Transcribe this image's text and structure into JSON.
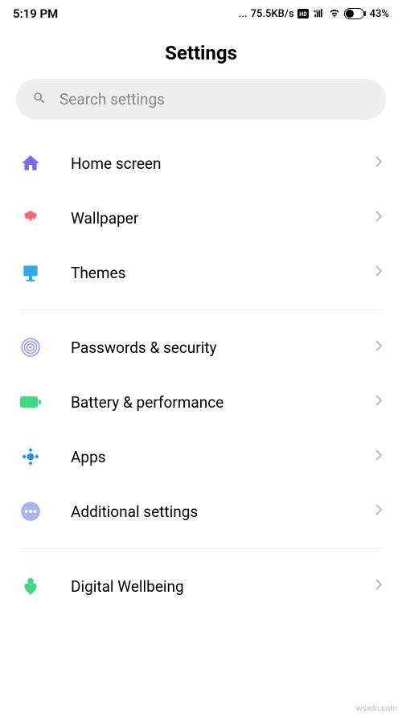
{
  "status_bar": {
    "time": "5:19 PM",
    "net_speed": "75.5KB/s",
    "battery_percent": "43%",
    "dots": "..."
  },
  "page": {
    "title": "Settings"
  },
  "search": {
    "placeholder": "Search settings"
  },
  "groups": [
    {
      "items": [
        {
          "icon": "home-icon",
          "color": "#7C6AE8",
          "label": "Home screen"
        },
        {
          "icon": "wallpaper-icon",
          "color": "#F06A7C",
          "label": "Wallpaper"
        },
        {
          "icon": "themes-icon",
          "color": "#2FA9E8",
          "label": "Themes"
        }
      ]
    },
    {
      "items": [
        {
          "icon": "fingerprint-icon",
          "color": "#9B9CE0",
          "label": "Passwords & security"
        },
        {
          "icon": "battery-icon",
          "color": "#3FD982",
          "label": "Battery & performance"
        },
        {
          "icon": "apps-icon",
          "color": "#2C8EEB",
          "label": "Apps"
        },
        {
          "icon": "additional-icon",
          "color": "#A8B5E8",
          "label": "Additional settings"
        }
      ]
    },
    {
      "items": [
        {
          "icon": "wellbeing-icon",
          "color": "#3FD982",
          "label": "Digital Wellbeing"
        }
      ]
    }
  ],
  "watermark": "wsxdn.com"
}
